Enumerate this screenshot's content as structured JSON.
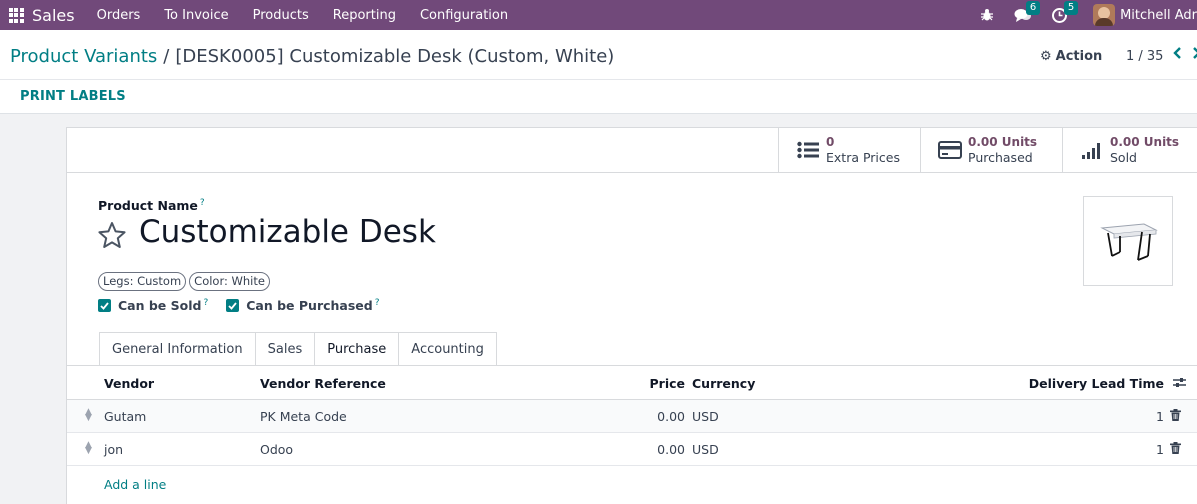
{
  "navbar": {
    "app_name": "Sales",
    "menu": [
      "Orders",
      "To Invoice",
      "Products",
      "Reporting",
      "Configuration"
    ],
    "messages_badge": "6",
    "activities_badge": "5",
    "user_name": "Mitchell Adr"
  },
  "control_panel": {
    "breadcrumb_parent": "Product Variants",
    "breadcrumb_separator": "/",
    "breadcrumb_current": "[DESK0005] Customizable Desk (Custom, White)",
    "action_label": "Action",
    "pager": "1 / 35",
    "print_labels": "PRINT LABELS"
  },
  "stat_buttons": {
    "extra_prices": {
      "value": "0",
      "label": "Extra Prices"
    },
    "purchased": {
      "value": "0.00 Units",
      "label": "Purchased"
    },
    "sold": {
      "value": "0.00 Units",
      "label": "Sold"
    }
  },
  "form": {
    "product_name_label": "Product Name",
    "help_marker": "?",
    "product_name": "Customizable Desk",
    "attribute_tags": [
      "Legs: Custom",
      "Color: White"
    ],
    "can_be_sold_label": "Can be Sold",
    "can_be_purchased_label": "Can be Purchased"
  },
  "tabs": [
    "General Information",
    "Sales",
    "Purchase",
    "Accounting"
  ],
  "active_tab": "Purchase",
  "vendors_table": {
    "headers": {
      "vendor": "Vendor",
      "vendor_reference": "Vendor Reference",
      "price": "Price",
      "currency": "Currency",
      "delivery_lead_time": "Delivery Lead Time"
    },
    "rows": [
      {
        "vendor": "Gutam",
        "vendor_reference": "PK Meta Code",
        "price": "0.00",
        "currency": "USD",
        "delivery_lead_time": "1"
      },
      {
        "vendor": "jon",
        "vendor_reference": "Odoo",
        "price": "0.00",
        "currency": "USD",
        "delivery_lead_time": "1"
      }
    ],
    "add_line": "Add a line"
  },
  "colors": {
    "navbar": "#71497a",
    "accent": "#017e84",
    "stat_value": "#714b67"
  }
}
